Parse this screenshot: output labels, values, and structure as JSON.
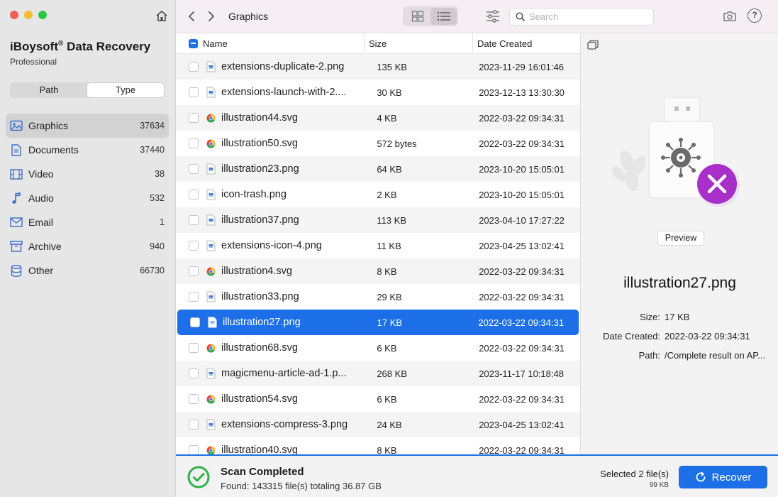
{
  "sidebar": {
    "brand_title": "iBoysoft",
    "brand_reg": "®",
    "brand_title_rest": " Data Recovery",
    "brand_subtitle": "Professional",
    "segments": {
      "path": "Path",
      "type": "Type",
      "active": "Type"
    },
    "categories": [
      {
        "label": "Graphics",
        "count": "37634",
        "icon": "image-icon",
        "selected": true
      },
      {
        "label": "Documents",
        "count": "37440",
        "icon": "document-icon",
        "selected": false
      },
      {
        "label": "Video",
        "count": "38",
        "icon": "film-icon",
        "selected": false
      },
      {
        "label": "Audio",
        "count": "532",
        "icon": "music-note-icon",
        "selected": false
      },
      {
        "label": "Email",
        "count": "1",
        "icon": "envelope-icon",
        "selected": false
      },
      {
        "label": "Archive",
        "count": "940",
        "icon": "archive-box-icon",
        "selected": false
      },
      {
        "label": "Other",
        "count": "66730",
        "icon": "database-icon",
        "selected": false
      }
    ]
  },
  "toolbar": {
    "breadcrumb": "Graphics",
    "search_placeholder": "Search",
    "view_mode": "list"
  },
  "list": {
    "columns": {
      "name": "Name",
      "size": "Size",
      "date": "Date Created"
    },
    "rows": [
      {
        "name": "extensions-duplicate-2.png",
        "size": "135 KB",
        "date": "2023-11-29 16:01:46",
        "type": "png",
        "selected": false
      },
      {
        "name": "extensions-launch-with-2....",
        "size": "30 KB",
        "date": "2023-12-13 13:30:30",
        "type": "png",
        "selected": false
      },
      {
        "name": "illustration44.svg",
        "size": "4 KB",
        "date": "2022-03-22 09:34:31",
        "type": "svg",
        "selected": false
      },
      {
        "name": "illustration50.svg",
        "size": "572 bytes",
        "date": "2022-03-22 09:34:31",
        "type": "svg",
        "selected": false
      },
      {
        "name": "illustration23.png",
        "size": "64 KB",
        "date": "2023-10-20 15:05:01",
        "type": "png",
        "selected": false
      },
      {
        "name": "icon-trash.png",
        "size": "2 KB",
        "date": "2023-10-20 15:05:01",
        "type": "png",
        "selected": false
      },
      {
        "name": "illustration37.png",
        "size": "113 KB",
        "date": "2023-04-10 17:27:22",
        "type": "png",
        "selected": false
      },
      {
        "name": "extensions-icon-4.png",
        "size": "11 KB",
        "date": "2023-04-25 13:02:41",
        "type": "png",
        "selected": false
      },
      {
        "name": "illustration4.svg",
        "size": "8 KB",
        "date": "2022-03-22 09:34:31",
        "type": "svg",
        "selected": false
      },
      {
        "name": "illustration33.png",
        "size": "29 KB",
        "date": "2022-03-22 09:34:31",
        "type": "png",
        "selected": false
      },
      {
        "name": "illustration27.png",
        "size": "17 KB",
        "date": "2022-03-22 09:34:31",
        "type": "png",
        "selected": true
      },
      {
        "name": "illustration68.svg",
        "size": "6 KB",
        "date": "2022-03-22 09:34:31",
        "type": "svg",
        "selected": false
      },
      {
        "name": "magicmenu-article-ad-1.p...",
        "size": "268 KB",
        "date": "2023-11-17 10:18:48",
        "type": "png",
        "selected": false
      },
      {
        "name": "illustration54.svg",
        "size": "6 KB",
        "date": "2022-03-22 09:34:31",
        "type": "svg",
        "selected": false
      },
      {
        "name": "extensions-compress-3.png",
        "size": "24 KB",
        "date": "2023-04-25 13:02:41",
        "type": "png",
        "selected": false
      },
      {
        "name": "illustration40.svg",
        "size": "8 KB",
        "date": "2022-03-22 09:34:31",
        "type": "svg",
        "selected": false
      }
    ]
  },
  "preview": {
    "button_label": "Preview",
    "file_name": "illustration27.png",
    "meta": [
      {
        "key": "Size:",
        "value": "17 KB"
      },
      {
        "key": "Date Created:",
        "value": "2022-03-22 09:34:31"
      },
      {
        "key": "Path:",
        "value": "/Complete result on AP..."
      }
    ]
  },
  "footer": {
    "status_title": "Scan Completed",
    "status_detail": "Found: 143315 file(s) totaling 36.87 GB",
    "selected_count": "Selected 2 file(s)",
    "selected_size": "99 KB",
    "recover_label": "Recover"
  },
  "colors": {
    "accent": "#1c6fe7",
    "success": "#2db34a",
    "error_badge": "#a92fc9"
  }
}
